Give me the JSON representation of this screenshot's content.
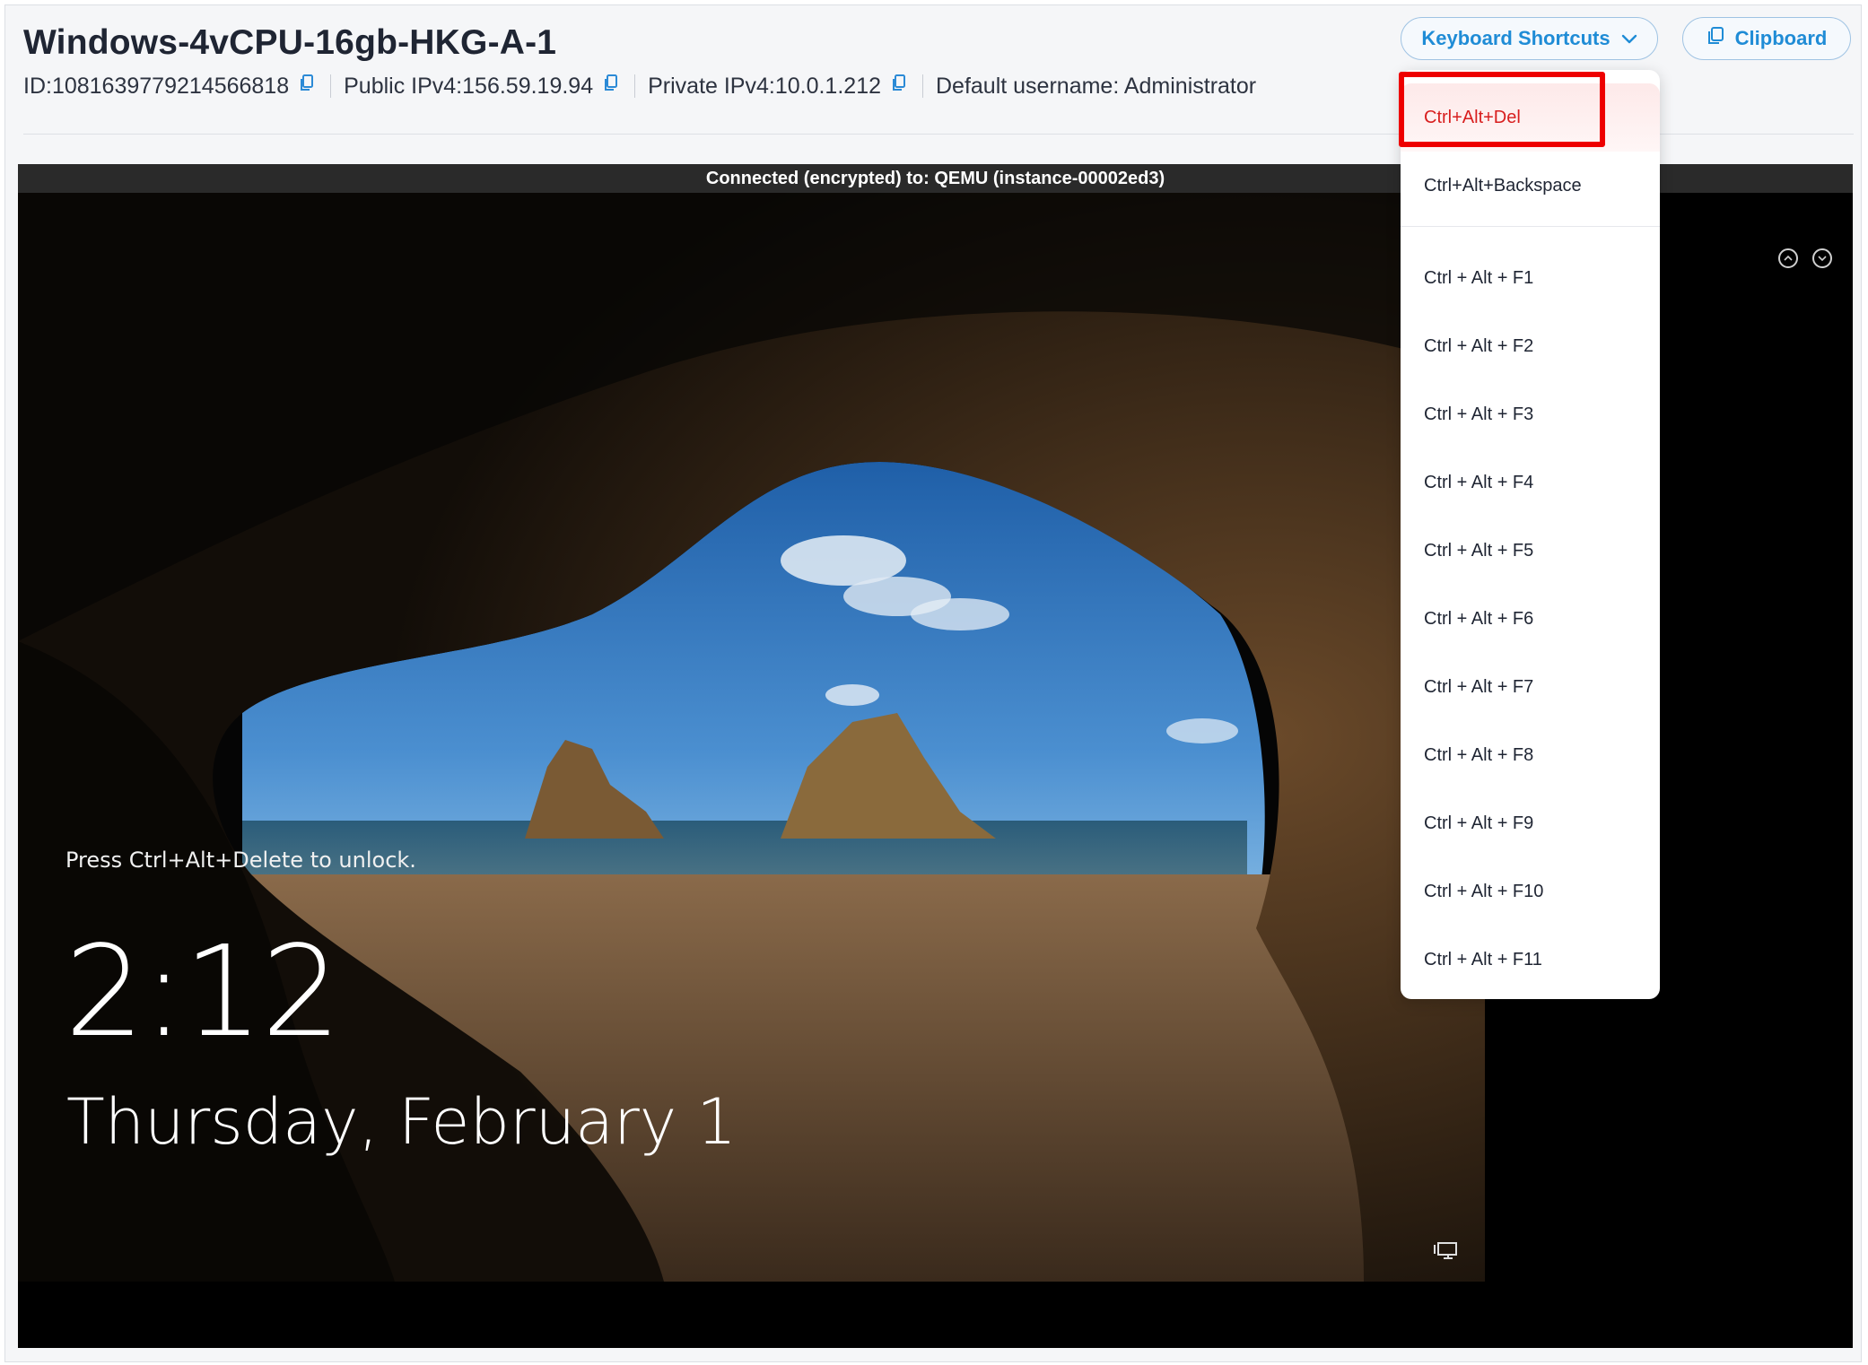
{
  "header": {
    "title": "Windows-4vCPU-16gb-HKG-A-1",
    "id_text": "ID:1081639779214566818",
    "public_ip_text": "Public IPv4:156.59.19.94",
    "private_ip_text": "Private IPv4:10.0.1.212",
    "username_text": "Default username: Administrator",
    "keyboard_shortcuts_label": "Keyboard Shortcuts",
    "clipboard_label": "Clipboard"
  },
  "console": {
    "status": "Connected (encrypted) to: QEMU (instance-00002ed3)",
    "lock_hint": "Press Ctrl+Alt+Delete to unlock.",
    "time": "2:12",
    "date": "Thursday, February 1"
  },
  "shortcuts": {
    "items": [
      "Ctrl+Alt+Del",
      "Ctrl+Alt+Backspace",
      "Ctrl + Alt + F1",
      "Ctrl + Alt + F2",
      "Ctrl + Alt + F3",
      "Ctrl + Alt + F4",
      "Ctrl + Alt + F5",
      "Ctrl + Alt + F6",
      "Ctrl + Alt + F7",
      "Ctrl + Alt + F8",
      "Ctrl + Alt + F9",
      "Ctrl + Alt + F10",
      "Ctrl + Alt + F11"
    ]
  },
  "icons": {
    "copy": "copy-icon",
    "chevron": "chevron-down-icon",
    "clipboard": "clipboard-icon",
    "scroll_up": "scroll-up-icon",
    "scroll_down": "scroll-down-icon",
    "network": "network-icon"
  },
  "colors": {
    "accent": "#1f8cd6",
    "active_item": "#d81e1e",
    "highlight": "#ee0000"
  }
}
